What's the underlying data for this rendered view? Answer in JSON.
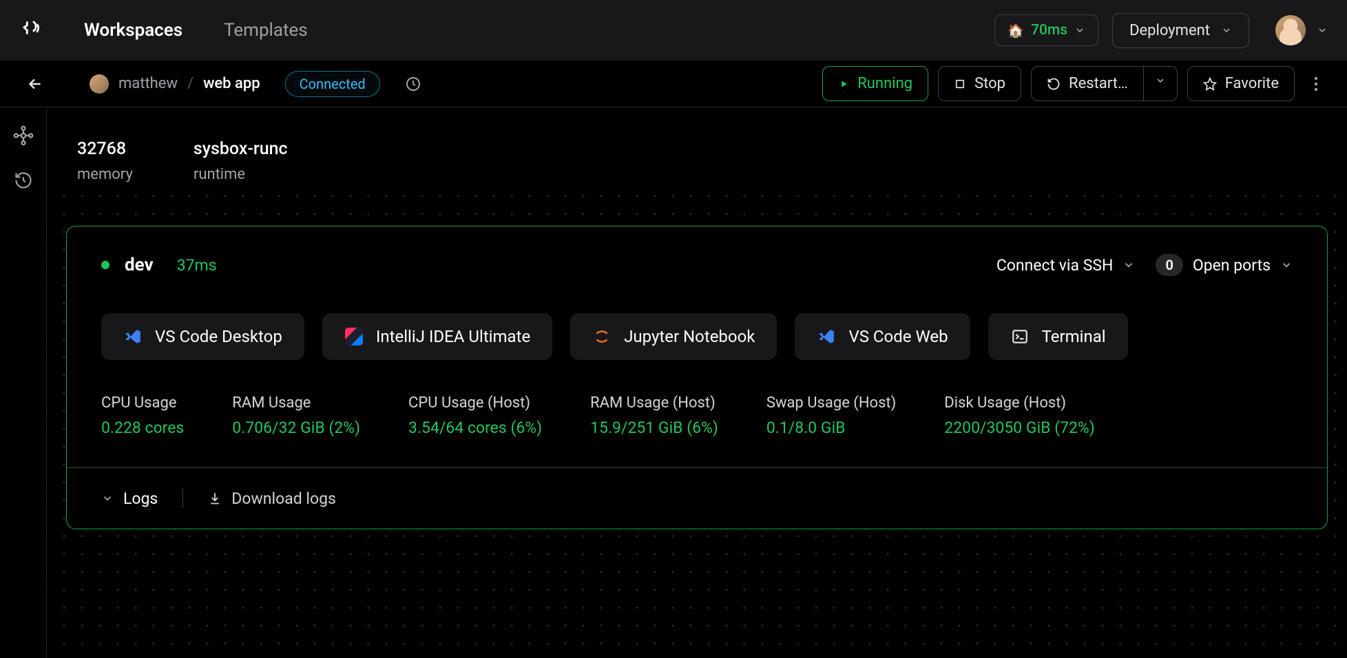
{
  "nav": {
    "workspaces_label": "Workspaces",
    "templates_label": "Templates",
    "latency_icon": "🏠",
    "latency_value": "70ms",
    "deployment_label": "Deployment"
  },
  "header": {
    "user": "matthew",
    "workspace": "web app",
    "status_badge": "Connected",
    "running_label": "Running",
    "stop_label": "Stop",
    "restart_label": "Restart…",
    "favorite_label": "Favorite"
  },
  "stats": {
    "memory_value": "32768",
    "memory_label": "memory",
    "runtime_value": "sysbox-runc",
    "runtime_label": "runtime"
  },
  "agent": {
    "name": "dev",
    "latency": "37ms",
    "ssh_label": "Connect via SSH",
    "ports_count": "0",
    "ports_label": "Open ports"
  },
  "apps": {
    "vscode_desktop": "VS Code Desktop",
    "intellij": "IntelliJ IDEA Ultimate",
    "jupyter": "Jupyter Notebook",
    "vscode_web": "VS Code Web",
    "terminal": "Terminal"
  },
  "metrics": {
    "cpu_label": "CPU Usage",
    "cpu_value": "0.228 cores",
    "ram_label": "RAM Usage",
    "ram_value": "0.706/32 GiB (2%)",
    "cpu_host_label": "CPU Usage (Host)",
    "cpu_host_value": "3.54/64 cores (6%)",
    "ram_host_label": "RAM Usage (Host)",
    "ram_host_value": "15.9/251 GiB (6%)",
    "swap_host_label": "Swap Usage (Host)",
    "swap_host_value": "0.1/8.0 GiB",
    "disk_host_label": "Disk Usage (Host)",
    "disk_host_value": "2200/3050 GiB (72%)"
  },
  "logs": {
    "label": "Logs",
    "download_label": "Download logs"
  }
}
